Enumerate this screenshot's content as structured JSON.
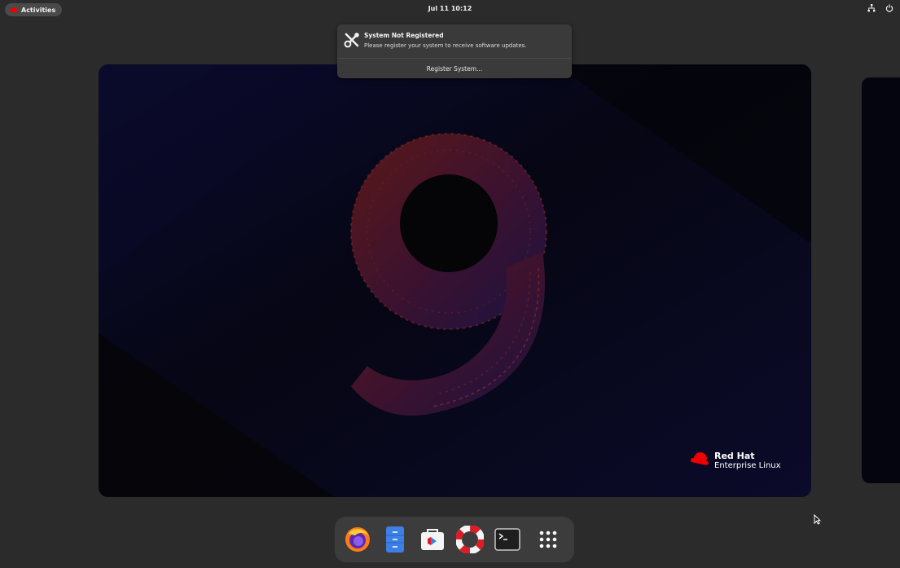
{
  "topbar": {
    "activities_label": "Activities",
    "clock": "Jul 11  10:12",
    "icons": [
      "network-icon",
      "power-icon"
    ]
  },
  "notification": {
    "icon": "tools-icon",
    "title": "System Not Registered",
    "body": "Please register your system to receive software updates.",
    "action_label": "Register System..."
  },
  "workspace": {
    "brand_line1": "Red Hat",
    "brand_line2": "Enterprise Linux",
    "wallpaper_symbol": "9"
  },
  "dash": {
    "items": [
      {
        "name": "firefox-icon",
        "app": "Firefox"
      },
      {
        "name": "files-icon",
        "app": "Files"
      },
      {
        "name": "software-icon",
        "app": "Software"
      },
      {
        "name": "help-icon",
        "app": "Help"
      },
      {
        "name": "terminal-icon",
        "app": "Terminal"
      },
      {
        "name": "app-grid-icon",
        "app": "Show Applications"
      }
    ]
  },
  "colors": {
    "accent_red": "#ee0000",
    "panel_bg": "#2b2b2b",
    "notification_bg": "#3a3a3a",
    "dash_bg": "#3c3c3c"
  }
}
